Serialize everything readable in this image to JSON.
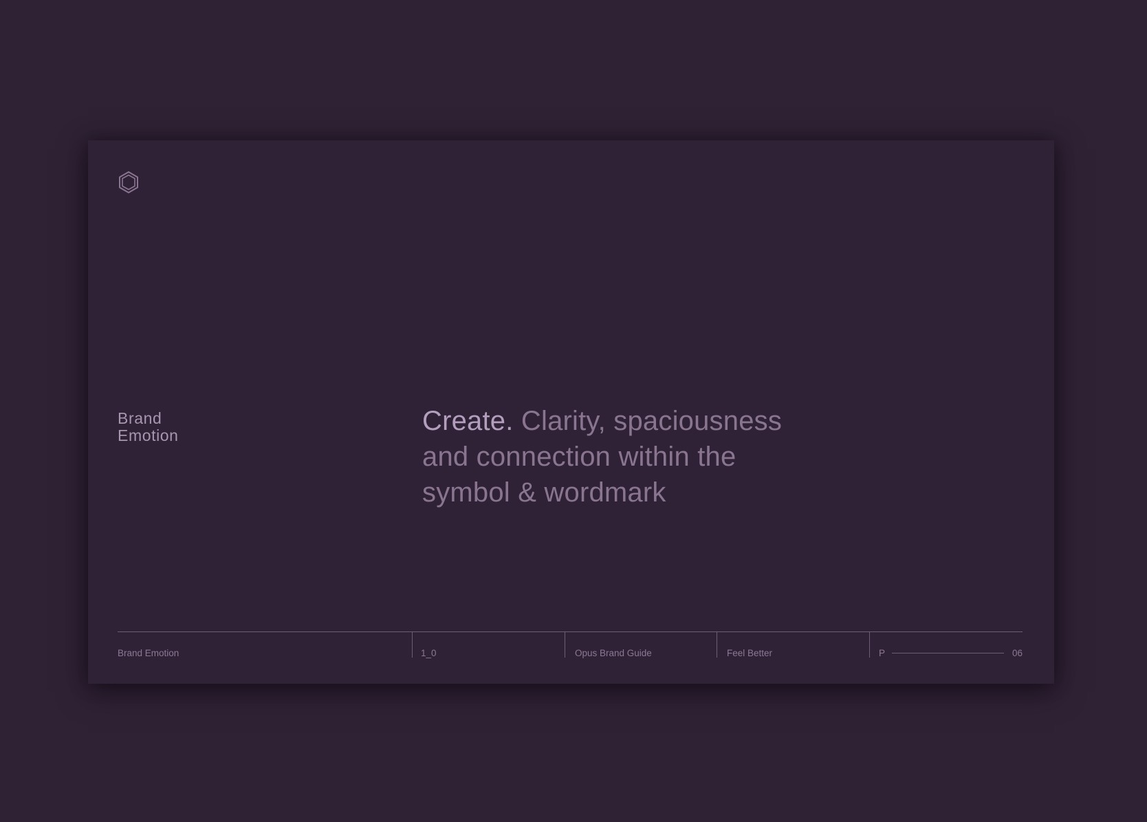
{
  "colors": {
    "background": "#2f2235",
    "card": "#302236",
    "headline_lead": "#b39fbd",
    "headline_body": "#8a7590",
    "rule": "#6f5d78"
  },
  "logo": {
    "icon": "hexagon-logo-icon"
  },
  "section_label": {
    "line1": "Brand",
    "line2": "Emotion"
  },
  "headline": {
    "lead": "Create.",
    "body": " Clarity, spaciousness and connection within the symbol  & wordmark"
  },
  "footer": {
    "section": "Brand Emotion",
    "version": "1_0",
    "document": "Opus Brand Guide",
    "tagline": "Feel Better",
    "page_prefix": "P",
    "page_number": "06"
  }
}
